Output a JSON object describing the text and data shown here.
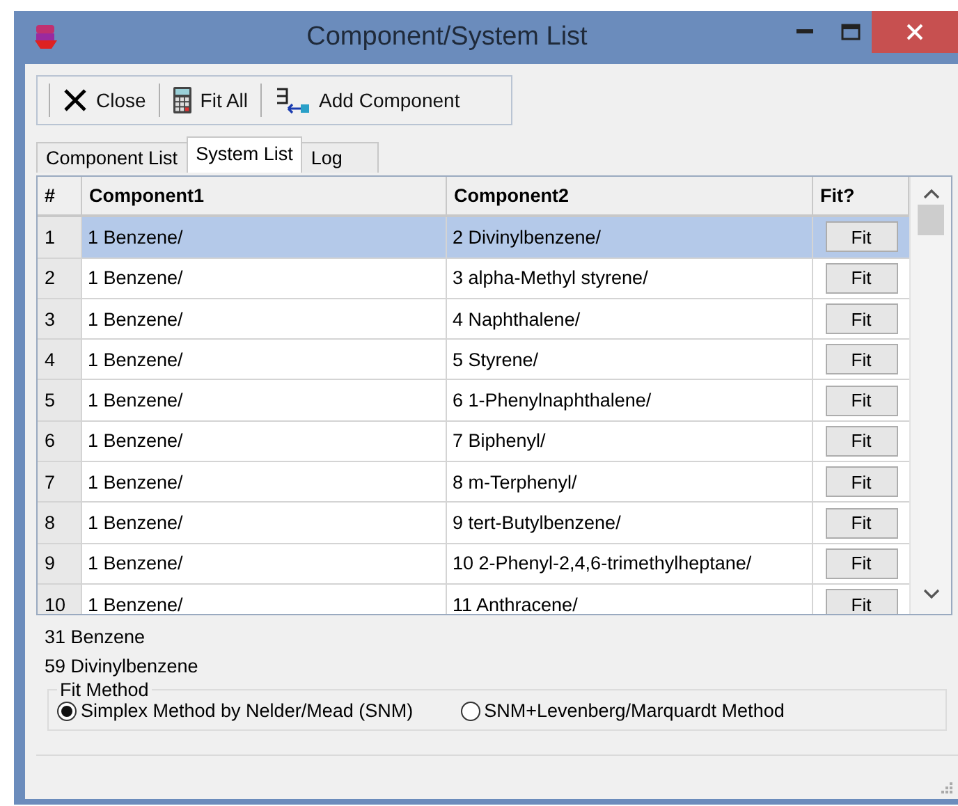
{
  "window": {
    "title": "Component/System List"
  },
  "toolbar": [
    {
      "label": "Close",
      "kind": "close"
    },
    {
      "label": "Fit All",
      "kind": "calc"
    },
    {
      "label": "Add Component",
      "kind": "add"
    }
  ],
  "tabs": [
    {
      "label": "Component List",
      "selected": false
    },
    {
      "label": "System List",
      "selected": true
    },
    {
      "label": "Log",
      "selected": false
    }
  ],
  "table": {
    "columns": [
      "#",
      "Component1",
      "Component2",
      "Fit?"
    ],
    "rows": [
      {
        "n": "1",
        "c1": "1 Benzene/",
        "c2": "2 Divinylbenzene/",
        "button": "Fit",
        "selected": true
      },
      {
        "n": "2",
        "c1": "1 Benzene/",
        "c2": "3 alpha-Methyl styrene/",
        "button": "Fit",
        "selected": false
      },
      {
        "n": "3",
        "c1": "1 Benzene/",
        "c2": "4 Naphthalene/",
        "button": "Fit",
        "selected": false
      },
      {
        "n": "4",
        "c1": "1 Benzene/",
        "c2": "5 Styrene/",
        "button": "Fit",
        "selected": false
      },
      {
        "n": "5",
        "c1": "1 Benzene/",
        "c2": "6 1-Phenylnaphthalene/",
        "button": "Fit",
        "selected": false
      },
      {
        "n": "6",
        "c1": "1 Benzene/",
        "c2": "7 Biphenyl/",
        "button": "Fit",
        "selected": false
      },
      {
        "n": "7",
        "c1": "1 Benzene/",
        "c2": "8 m-Terphenyl/",
        "button": "Fit",
        "selected": false
      },
      {
        "n": "8",
        "c1": "1 Benzene/",
        "c2": "9 tert-Butylbenzene/",
        "button": "Fit",
        "selected": false
      },
      {
        "n": "9",
        "c1": "1 Benzene/",
        "c2": "10 2-Phenyl-2,4,6-trimethylheptane/",
        "button": "Fit",
        "selected": false
      },
      {
        "n": "10",
        "c1": "1 Benzene/",
        "c2": "11 Anthracene/",
        "button": "Fit",
        "selected": false
      }
    ]
  },
  "info_lines": [
    "31 Benzene",
    "59 Divinylbenzene"
  ],
  "fit_method": {
    "title": "Fit Method",
    "options": [
      {
        "label": "Simplex Method by Nelder/Mead (SNM)",
        "selected": true
      },
      {
        "label": "SNM+Levenberg/Marquardt Method",
        "selected": false
      }
    ]
  }
}
